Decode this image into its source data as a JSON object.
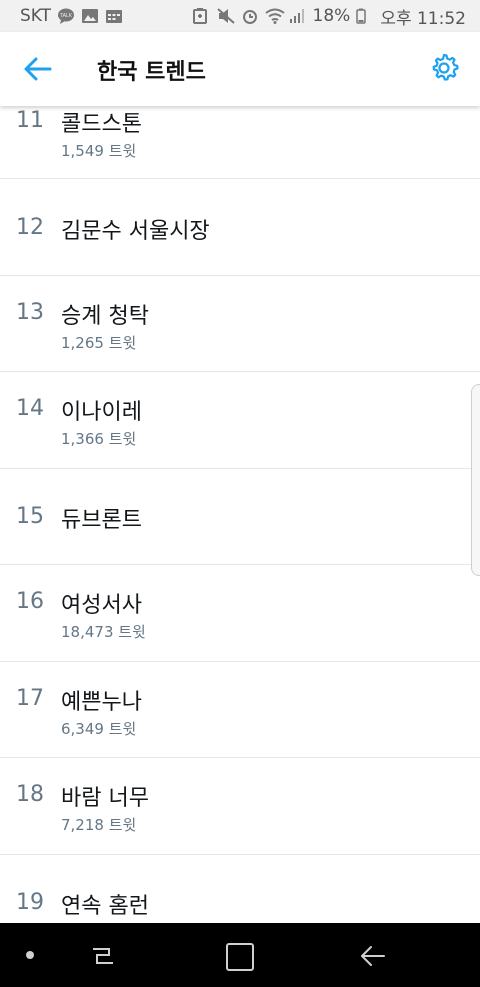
{
  "statusbar": {
    "carrier": "SKT",
    "battery": "18%",
    "time": "오후 11:52",
    "icons": [
      "talk-icon",
      "gallery-icon",
      "calendar-icon",
      "battery-saver-icon",
      "mute-icon",
      "alarm-icon",
      "wifi-icon",
      "signal-icon",
      "battery-icon"
    ]
  },
  "header": {
    "title": "한국 트렌드",
    "back_icon": "arrow-left-icon",
    "settings_icon": "gear-icon",
    "accent": "#1da1f2"
  },
  "trends": [
    {
      "rank": "11",
      "name": "콜드스톤",
      "count": "1,549 트윗"
    },
    {
      "rank": "12",
      "name": "김문수 서울시장",
      "count": ""
    },
    {
      "rank": "13",
      "name": "승계 청탁",
      "count": "1,265 트윗"
    },
    {
      "rank": "14",
      "name": "이나이레",
      "count": "1,366 트윗"
    },
    {
      "rank": "15",
      "name": "듀브론트",
      "count": ""
    },
    {
      "rank": "16",
      "name": "여성서사",
      "count": "18,473 트윗"
    },
    {
      "rank": "17",
      "name": "예쁜누나",
      "count": "6,349 트윗"
    },
    {
      "rank": "18",
      "name": "바람 너무",
      "count": "7,218 트윗"
    },
    {
      "rank": "19",
      "name": "연속 홈런",
      "count": ""
    }
  ],
  "navbar": {
    "icons": [
      "assistant-dot-icon",
      "recent-apps-icon",
      "home-icon",
      "back-icon"
    ]
  }
}
